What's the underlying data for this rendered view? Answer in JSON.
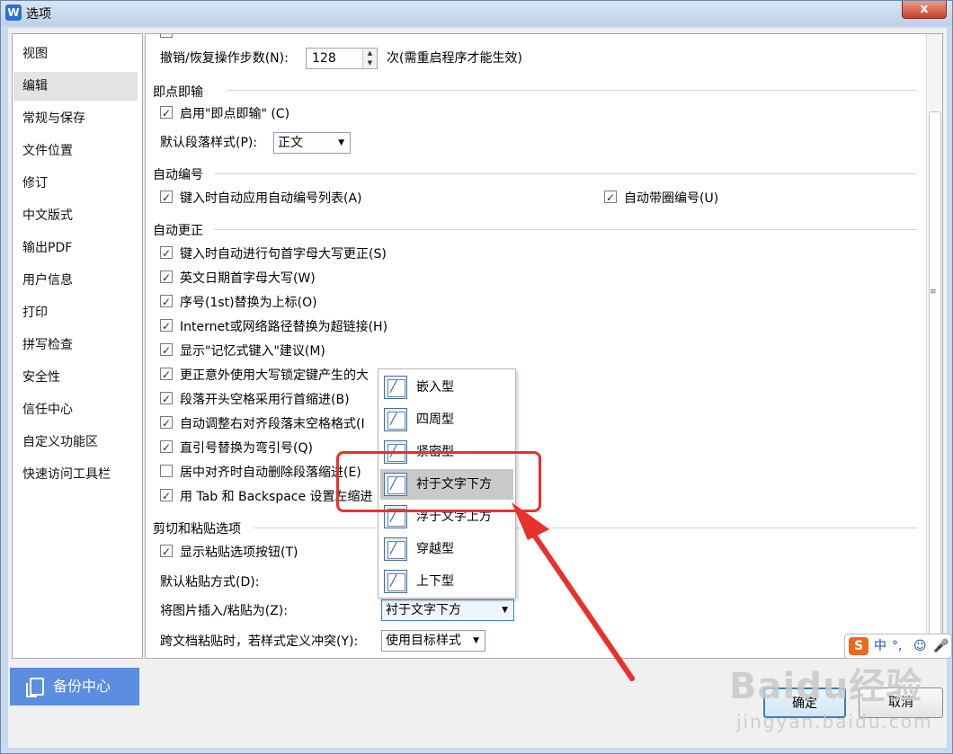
{
  "window": {
    "title": "选项",
    "close": "x"
  },
  "nav": {
    "items": [
      "视图",
      "编辑",
      "常规与保存",
      "文件位置",
      "修订",
      "中文版式",
      "输出PDF",
      "用户信息",
      "打印",
      "拼写检查",
      "安全性",
      "信任中心",
      "自定义功能区",
      "快速访问工具栏"
    ],
    "selected": "编辑",
    "backup_label": "备份中心"
  },
  "undo": {
    "label": "撤销/恢复操作步数(N):",
    "value": "128",
    "suffix": "次(需重启程序才能生效)"
  },
  "click_type": {
    "title": "即点即输",
    "enable": {
      "label": "启用\"即点即输\" (C)",
      "checked": true
    },
    "para_style_label": "默认段落样式(P):",
    "para_style_value": "正文"
  },
  "auto_number": {
    "title": "自动编号",
    "apply_list": {
      "label": "键入时自动应用自动编号列表(A)",
      "checked": true
    },
    "circled": {
      "label": "自动带圈编号(U)",
      "checked": true
    }
  },
  "autocorrect": {
    "title": "自动更正",
    "items": [
      {
        "label": "键入时自动进行句首字母大写更正(S)",
        "checked": true
      },
      {
        "label": "英文日期首字母大写(W)",
        "checked": true
      },
      {
        "label": "序号(1st)替换为上标(O)",
        "checked": true
      },
      {
        "label": "Internet或网络路径替换为超链接(H)",
        "checked": true
      },
      {
        "label": "显示\"记忆式键入\"建议(M)",
        "checked": true
      },
      {
        "label": "更正意外使用大写锁定键产生的大",
        "checked": true
      },
      {
        "label": "段落开头空格采用行首缩进(B)",
        "checked": true
      },
      {
        "label": "自动调整右对齐段落末空格格式(I",
        "checked": true
      },
      {
        "label": "直引号替换为弯引号(Q)",
        "checked": true
      },
      {
        "label": "居中对齐时自动删除段落缩进(E)",
        "checked": false
      },
      {
        "label": "用 Tab 和 Backspace 设置左缩进",
        "checked": true
      }
    ]
  },
  "paste": {
    "title": "剪切和粘贴选项",
    "show_button": {
      "label": "显示粘贴选项按钮(T)",
      "checked": true
    },
    "default_label": "默认粘贴方式(D):",
    "insert_label": "将图片插入/粘贴为(Z):",
    "insert_value": "衬于文字下方",
    "cross_doc_label": "跨文档粘贴时，若样式定义冲突(Y):",
    "cross_doc_value": "使用目标样式"
  },
  "dropdown": {
    "options": [
      "嵌入型",
      "四周型",
      "紧密型",
      "衬于文字下方",
      "浮于文字上方",
      "穿越型",
      "上下型"
    ],
    "highlighted": "衬于文字下方"
  },
  "buttons": {
    "ok": "确定",
    "cancel": "取消"
  },
  "ime": {
    "logo": "S",
    "mode": "中",
    "punct": "°,",
    "emoji": "☺",
    "mic": "🎤"
  },
  "watermark": {
    "line1": "Baidu经验",
    "line2": "jingyan.baidu.com"
  },
  "colors": {
    "accent": "#5b8de0",
    "annotation": "#e8312a"
  }
}
